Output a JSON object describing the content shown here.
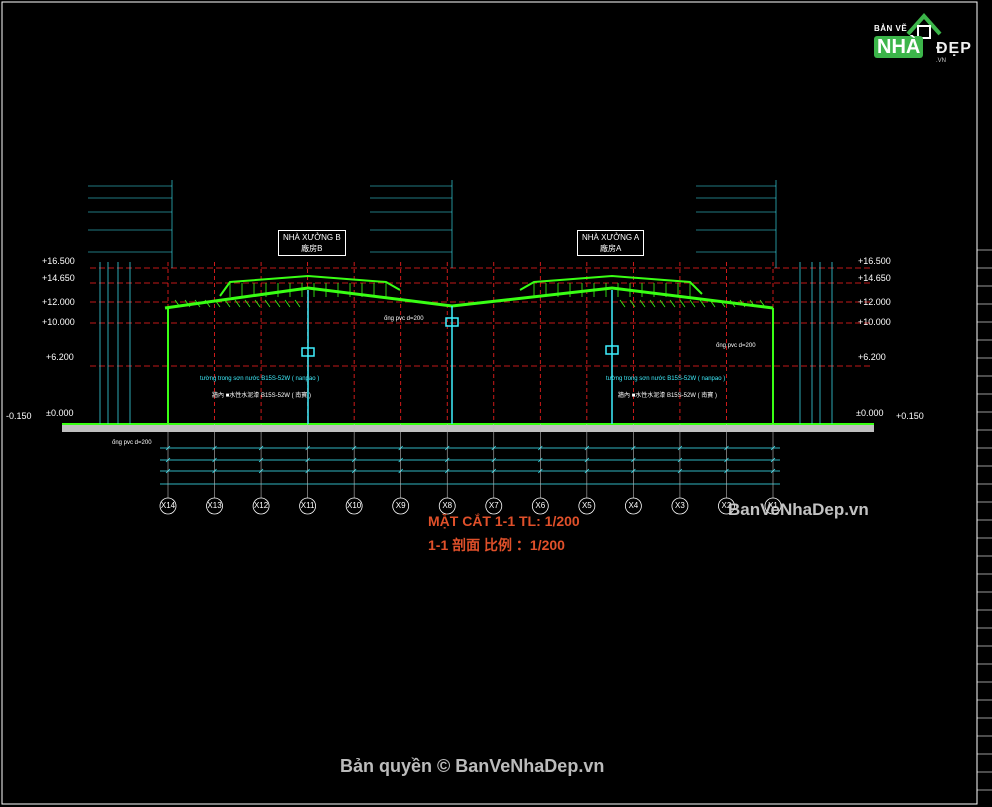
{
  "logo": {
    "top": "BẢN VẼ",
    "main": "NHÀ",
    "sub": "ĐẸP",
    "url": ".VN",
    "house_icon": "house-icon"
  },
  "watermark_right": "BanVeNhaDep.vn",
  "watermark_bottom": "Bản quyền © BanVeNhaDep.vn",
  "drawing_title": "MẶT CẮT 1-1   TL: 1/200",
  "drawing_title_cn": "1-1 剖面  比例 ：1/200",
  "buildings": [
    {
      "name": "NHÀ XƯỞNG B",
      "cn": "廠房B"
    },
    {
      "name": "NHÀ XƯỞNG A",
      "cn": "廠房A"
    }
  ],
  "levels_left": [
    "+16.500",
    "+14.650",
    "+12.000",
    "+10.000",
    "+6.200",
    "±0.000",
    "-0.150"
  ],
  "levels_right": [
    "+16.500",
    "+14.650",
    "+12.000",
    "+10.000",
    "+6.200",
    "±0.000",
    "+0.150"
  ],
  "grid_axes": [
    "X14",
    "X13",
    "X12",
    "X11",
    "X10",
    "X9",
    "X8",
    "X7",
    "X6",
    "X5",
    "X4",
    "X3",
    "X2",
    "X1"
  ],
  "notes": {
    "wall_left": "tường trong sơn nước B15S-52W ( nanpao )",
    "wall_left_cn": "牆內 ■水性水泥漆 B15S-52W ( 南寶 )",
    "wall_right": "tường trong sơn nước B15S-52W ( nanpao )",
    "wall_right_cn": "牆內 ■水性水泥漆 B15S-52W ( 南寶 )",
    "pipe_mid": "ống pvc d=200",
    "pipe_right": "ống pvc d=200",
    "pipe_left": "ống pvc d=200"
  },
  "colors": {
    "frame": "#39ff14",
    "grid_red": "#ff2020",
    "dim_cyan": "#3ff0ff",
    "title": "#e0502a",
    "ground": "#ffffff"
  }
}
